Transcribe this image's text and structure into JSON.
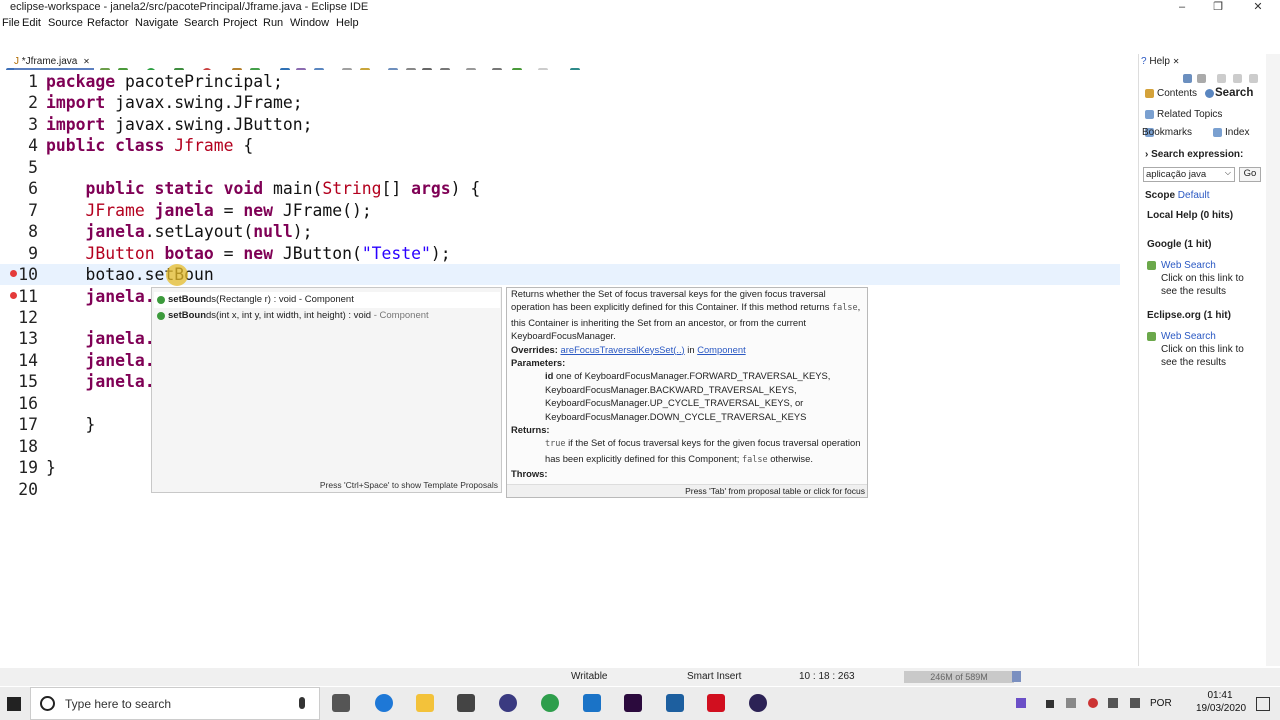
{
  "window": {
    "title": "eclipse-workspace - janela2/src/pacotePrincipal/Jframe.java - Eclipse IDE",
    "minimize": "–",
    "maximize": "❐",
    "close": "✕"
  },
  "menu": [
    "File",
    "Edit",
    "Source",
    "Refactor",
    "Navigate",
    "Search",
    "Project",
    "Run",
    "Window",
    "Help"
  ],
  "editor": {
    "tab_label": "*Jframe.java",
    "tab_close": "✕",
    "lines": [
      {
        "n": "1",
        "code": [
          [
            "kw",
            "package"
          ],
          [
            "",
            " pacotePrincipal;"
          ]
        ]
      },
      {
        "n": "2",
        "code": [
          [
            "kw",
            "import"
          ],
          [
            "",
            " javax.swing.JFrame;"
          ]
        ]
      },
      {
        "n": "3",
        "code": [
          [
            "kw",
            "import"
          ],
          [
            "",
            " javax.swing.JButton;"
          ]
        ]
      },
      {
        "n": "4",
        "code": [
          [
            "kw",
            "public class"
          ],
          [
            "",
            " "
          ],
          [
            "ty",
            "Jframe"
          ],
          [
            "",
            " {"
          ]
        ]
      },
      {
        "n": "5",
        "code": []
      },
      {
        "n": "6",
        "code": [
          [
            "",
            "    "
          ],
          [
            "kw",
            "public static void"
          ],
          [
            "",
            " main("
          ],
          [
            "ty",
            "String"
          ],
          [
            "",
            "[] "
          ],
          [
            "kw",
            "args"
          ],
          [
            "",
            ") {"
          ]
        ]
      },
      {
        "n": "7",
        "code": [
          [
            "",
            "    "
          ],
          [
            "ty",
            "JFrame"
          ],
          [
            "",
            " "
          ],
          [
            "kw",
            "janela"
          ],
          [
            "",
            " = "
          ],
          [
            "kw",
            "new"
          ],
          [
            "",
            " JFrame();"
          ]
        ]
      },
      {
        "n": "8",
        "code": [
          [
            "",
            "    "
          ],
          [
            "kw",
            "janela"
          ],
          [
            "",
            ".setLayout("
          ],
          [
            "kw",
            "null"
          ],
          [
            "",
            ");"
          ]
        ]
      },
      {
        "n": "9",
        "code": [
          [
            "",
            "    "
          ],
          [
            "ty",
            "JButton"
          ],
          [
            "",
            " "
          ],
          [
            "kw",
            "botao"
          ],
          [
            "",
            " = "
          ],
          [
            "kw",
            "new"
          ],
          [
            "",
            " JButton("
          ],
          [
            "st",
            "\"Teste\""
          ],
          [
            "",
            ");"
          ]
        ]
      },
      {
        "n": "10",
        "code": [
          [
            "",
            "    botao.setBoun"
          ]
        ]
      },
      {
        "n": "11",
        "code": [
          [
            "",
            "    "
          ],
          [
            "kw",
            "janela."
          ]
        ]
      },
      {
        "n": "12",
        "code": []
      },
      {
        "n": "13",
        "code": [
          [
            "",
            "    "
          ],
          [
            "kw",
            "janela."
          ]
        ]
      },
      {
        "n": "14",
        "code": [
          [
            "",
            "    "
          ],
          [
            "kw",
            "janela."
          ]
        ]
      },
      {
        "n": "15",
        "code": [
          [
            "",
            "    "
          ],
          [
            "kw",
            "janela."
          ]
        ]
      },
      {
        "n": "16",
        "code": []
      },
      {
        "n": "17",
        "code": [
          [
            "",
            "    }"
          ]
        ]
      },
      {
        "n": "18",
        "code": []
      },
      {
        "n": "19",
        "code": [
          [
            "",
            "}"
          ]
        ]
      },
      {
        "n": "20",
        "code": []
      }
    ]
  },
  "proposals": {
    "items": [
      {
        "bold": "setBoun",
        "rest": "ds(Rectangle r) : void - Component",
        "grey": ""
      },
      {
        "bold": "setBoun",
        "rest": "ds(int x, int y, int width, int height) : void",
        "grey": " - Component"
      }
    ],
    "footer": "Press 'Ctrl+Space' to show Template Proposals"
  },
  "javadoc": {
    "desc_1": "Returns whether the Set of focus traversal keys for the given focus traversal operation has been explicitly defined for this Container. If this method returns ",
    "desc_false": "false",
    "desc_2": ", this Container is inheriting the Set from an ancestor, or from the current KeyboardFocusManager.",
    "overrides_label": "Overrides:",
    "overrides_link": "areFocusTraversalKeysSet(..)",
    "overrides_in": " in ",
    "overrides_class": "Component",
    "params_label": "Parameters:",
    "param_name": "id",
    "param_desc": " one of KeyboardFocusManager.FORWARD_TRAVERSAL_KEYS, KeyboardFocusManager.BACKWARD_TRAVERSAL_KEYS, KeyboardFocusManager.UP_CYCLE_TRAVERSAL_KEYS, or KeyboardFocusManager.DOWN_CYCLE_TRAVERSAL_KEYS",
    "returns_label": "Returns:",
    "returns_true": "true",
    "returns_desc": " if the Set of focus traversal keys for the given focus traversal operation has been explicitly defined for this Component; ",
    "returns_false": "false",
    "returns_end": " otherwise.",
    "throws_label": "Throws:",
    "footer": "Press 'Tab' from proposal table or click for focus"
  },
  "help": {
    "tab_label": "Help",
    "tab_close": "✕",
    "contents": "Contents",
    "search": "Search",
    "related": "Related Topics",
    "bookmarks": "Bookmarks",
    "index": "Index",
    "search_expression": "Search expression:",
    "search_value": "aplicação java",
    "go": "Go",
    "scope_label": "Scope",
    "scope_value": "Default",
    "local_help": "Local Help (0 hits)",
    "google": "Google (1 hit)",
    "web_search_1": "Web Search",
    "click_1a": "Click on this link to",
    "click_1b": "see the results",
    "eclipse_org": "Eclipse.org (1 hit)",
    "web_search_2": "Web Search",
    "click_2a": "Click on this link to",
    "click_2b": "see the results"
  },
  "status": {
    "writable": "Writable",
    "insert": "Smart Insert",
    "position": "10 : 18 : 263",
    "heap": "246M of 589M"
  },
  "taskbar": {
    "search_placeholder": "Type here to search",
    "lang": "POR",
    "time": "01:41",
    "date": "19/03/2020"
  },
  "colors": {
    "keyword": "#7f0055",
    "type": "#b3001e",
    "string": "#2a00ff",
    "link": "#2b59c3",
    "current_line": "#e8f2fe"
  }
}
